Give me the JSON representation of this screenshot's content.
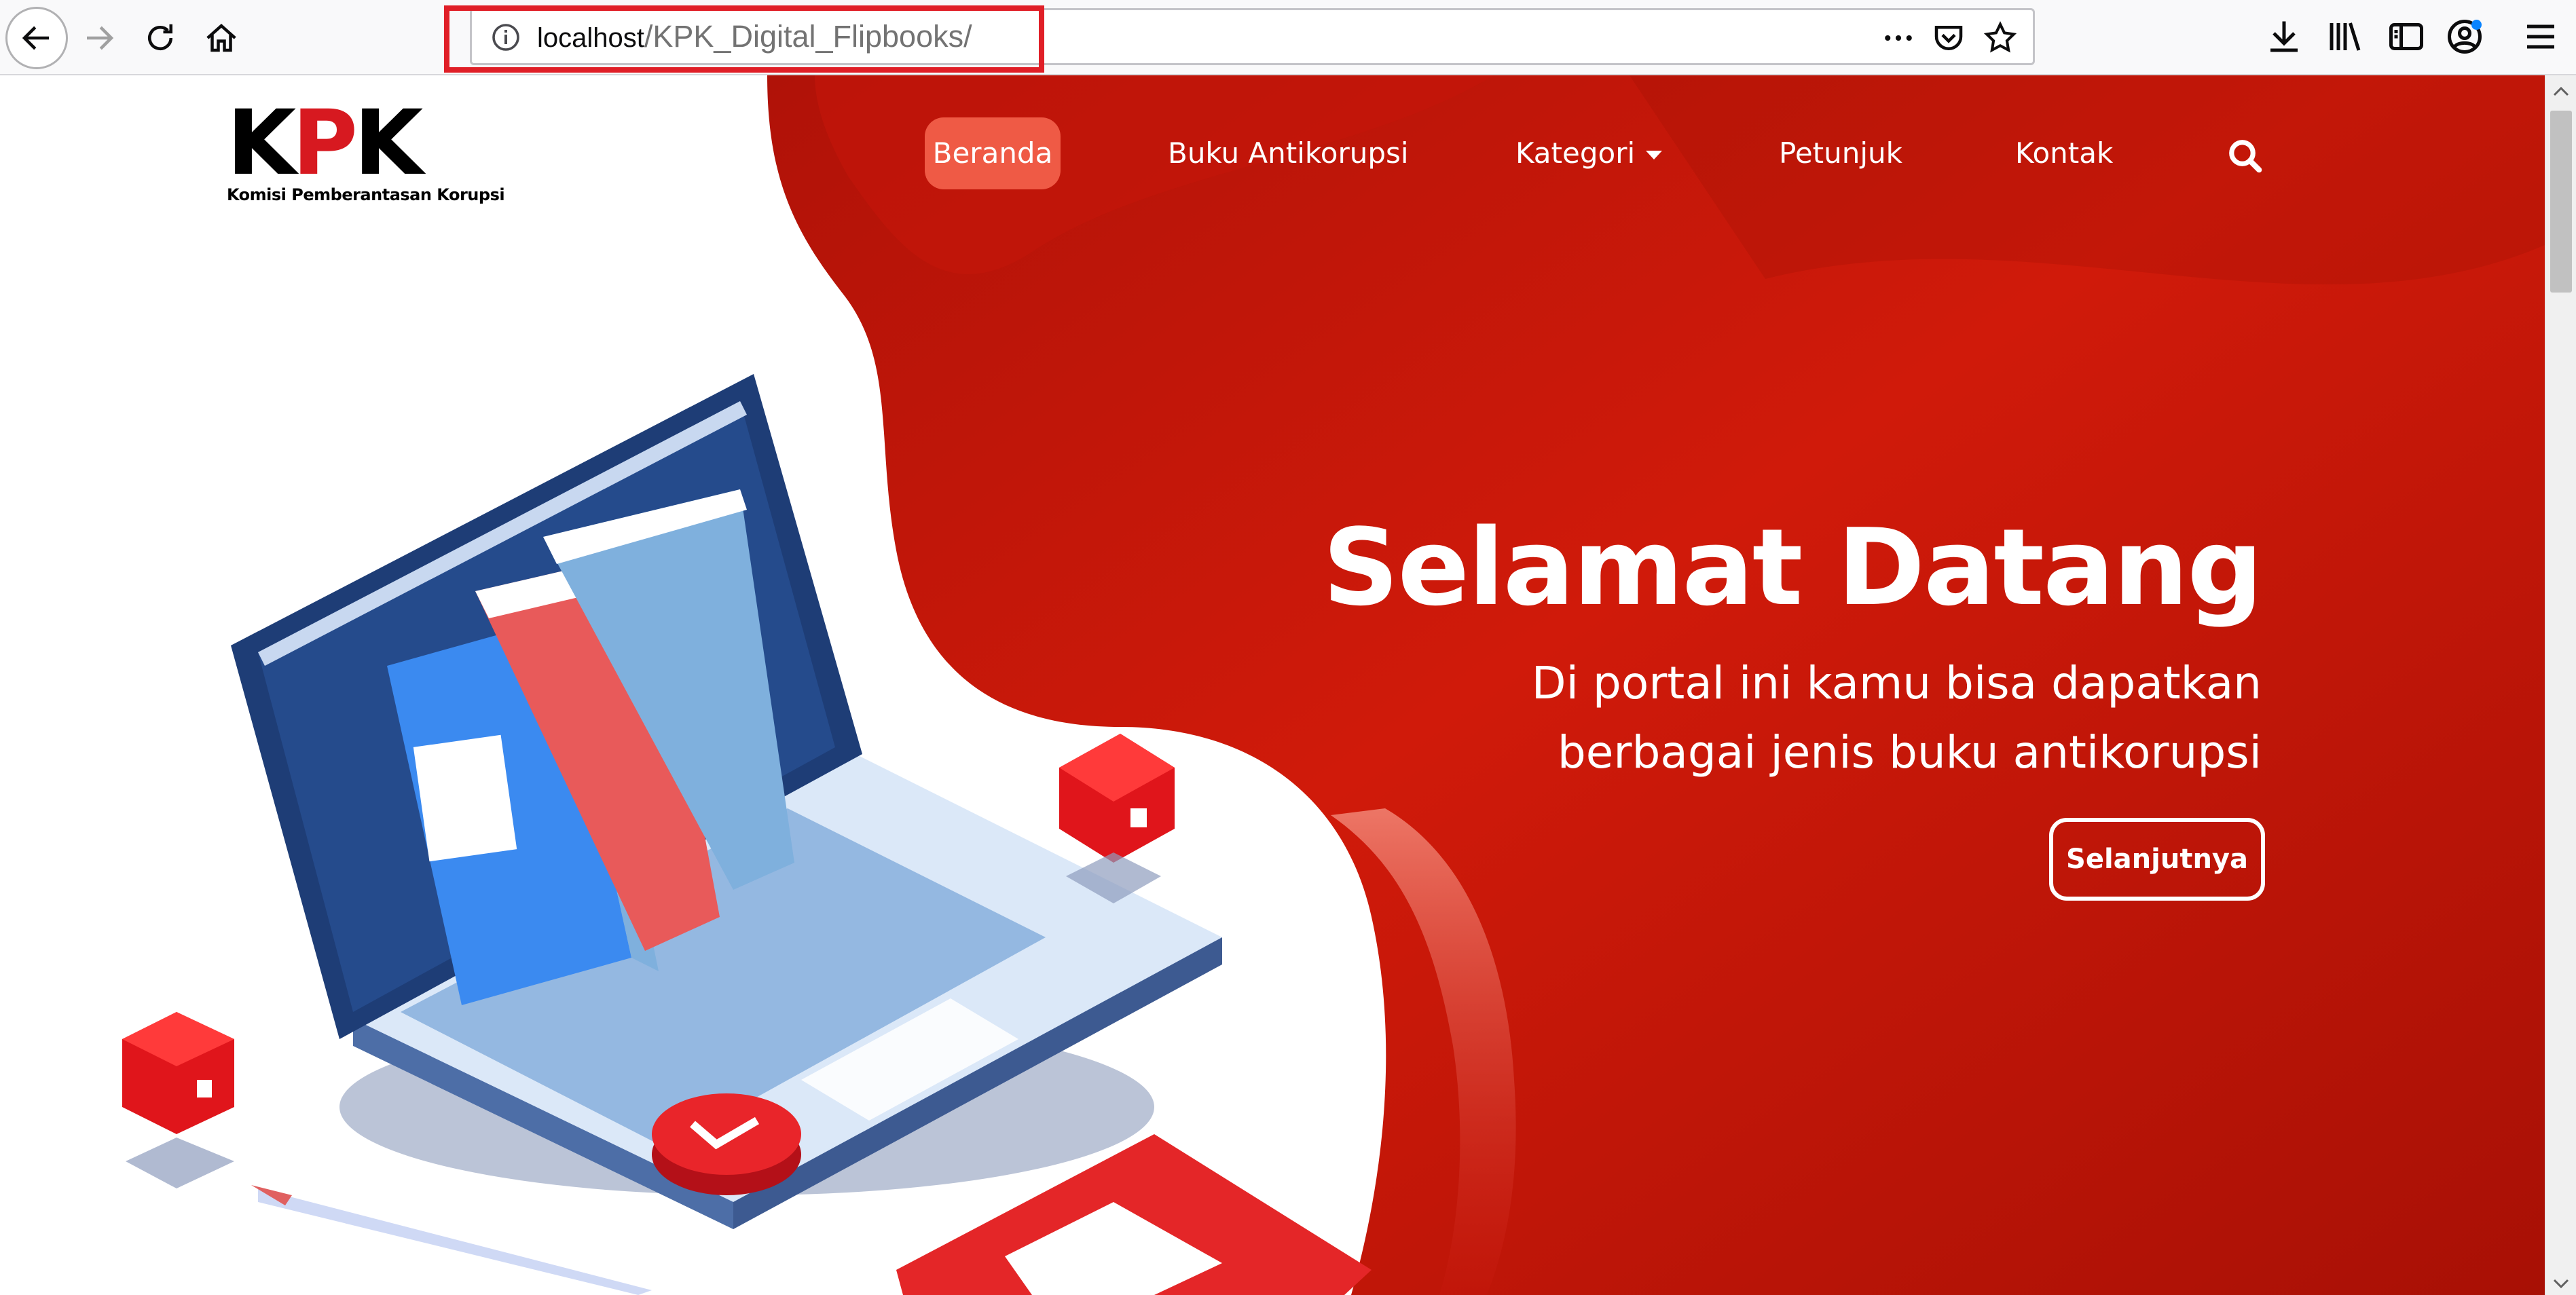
{
  "browser": {
    "url_host": "localhost",
    "url_path": "/KPK_Digital_Flipbooks/",
    "icons": {
      "back": "back-arrow-icon",
      "forward": "forward-arrow-icon",
      "reload": "reload-icon",
      "home": "home-icon",
      "info": "info-icon",
      "more": "more-dots-icon",
      "pocket": "pocket-icon",
      "bookmark": "star-icon",
      "downloads": "download-icon",
      "library": "library-icon",
      "sidebar": "sidebar-icon",
      "account": "account-icon",
      "menu": "hamburger-menu-icon"
    },
    "highlight_color": "#e01f27"
  },
  "site": {
    "logo_text_k": "K",
    "logo_text_p": "P",
    "logo_text_k2": "K",
    "logo_subtitle": "Komisi Pemberantasan Korupsi",
    "nav": {
      "home": "Beranda",
      "books": "Buku Antikorupsi",
      "category": "Kategori",
      "guide": "Petunjuk",
      "contact": "Kontak"
    },
    "hero": {
      "title": "Selamat Datang",
      "subtitle_line1": "Di portal ini kamu bisa dapatkan",
      "subtitle_line2": "berbagai jenis buku antikorupsi",
      "cta": "Selanjutnya"
    },
    "colors": {
      "hero_red": "#c8180d",
      "hero_dark_red": "#9c1005",
      "nav_active": "#ef5a45"
    }
  }
}
